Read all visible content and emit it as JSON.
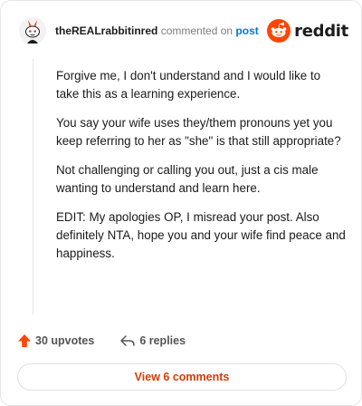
{
  "header": {
    "username": "theREALrabbitinred",
    "action_text": "commented on",
    "post_link": "post",
    "brand_name": "reddit"
  },
  "comment": {
    "paragraphs": [
      "Forgive me, I don't understand and I would like to take this as a learning experience.",
      "You say your wife uses they/them pronouns yet you keep referring to her as \"she\" is that still appropriate?",
      "Not challenging or calling you out, just a cis male wanting to understand and learn here.",
      "EDIT: My apologies OP, I misread your post. Also definitely NTA, hope you and your wife find peace and happiness."
    ]
  },
  "actions": {
    "upvotes": "30 upvotes",
    "replies": "6 replies"
  },
  "view_button": "View 6 comments",
  "colors": {
    "accent": "#ff4500",
    "link": "#0079d3",
    "view_button_text": "#d93a00"
  },
  "icons": {
    "avatar": "snoo-avatar-icon",
    "brand": "reddit-logo-icon",
    "upvote": "upvote-arrow-icon",
    "reply": "reply-arrow-icon"
  }
}
